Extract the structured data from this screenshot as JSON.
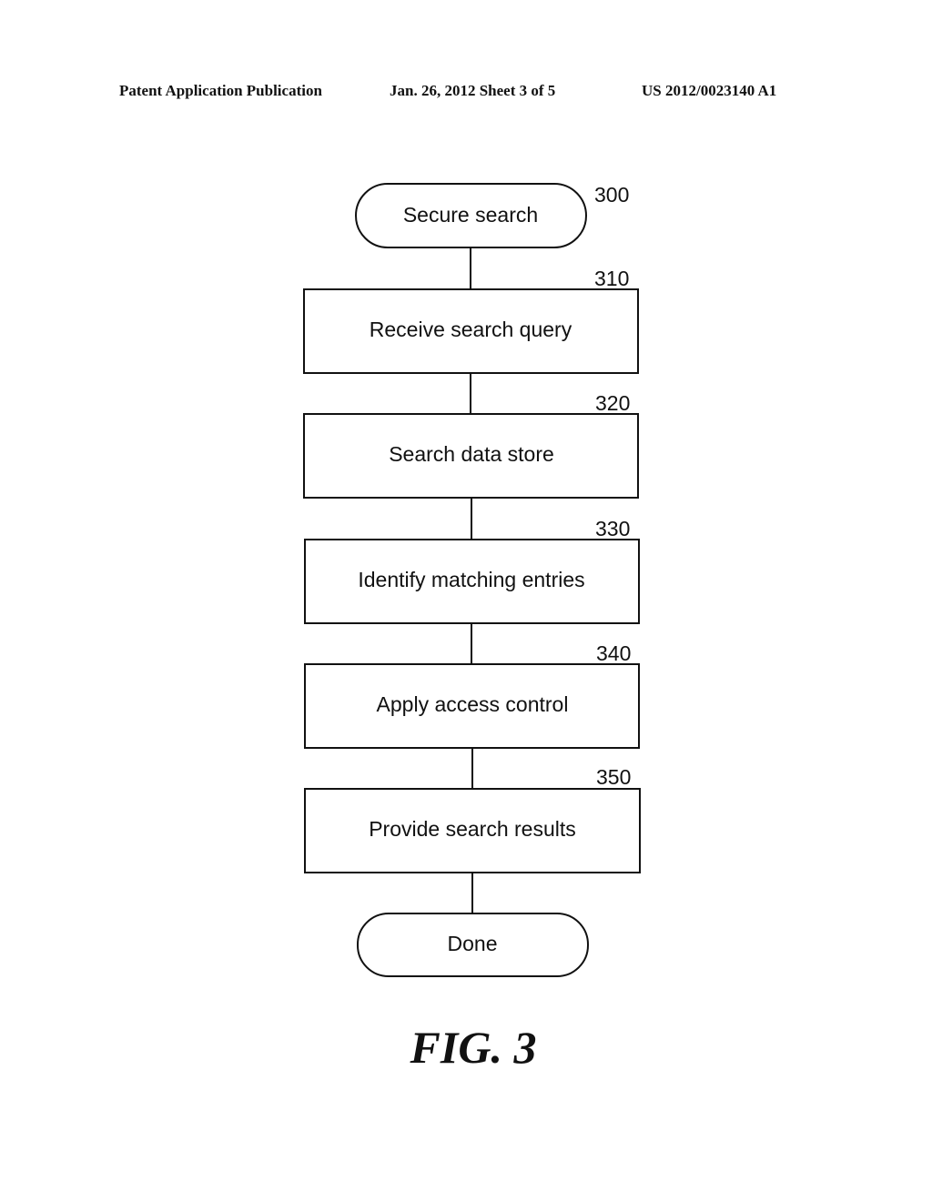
{
  "header": {
    "publication": "Patent Application Publication",
    "date_sheet": "Jan. 26, 2012   Sheet 3 of 5",
    "patent_number": "US 2012/0023140 A1"
  },
  "flowchart": {
    "start": {
      "ref": "300",
      "label": "Secure search"
    },
    "steps": [
      {
        "ref": "310",
        "label": "Receive search query"
      },
      {
        "ref": "320",
        "label": "Search data store"
      },
      {
        "ref": "330",
        "label": "Identify matching entries"
      },
      {
        "ref": "340",
        "label": "Apply access control"
      },
      {
        "ref": "350",
        "label": "Provide search results"
      }
    ],
    "end": {
      "label": "Done"
    }
  },
  "figure_label": "FIG. 3"
}
